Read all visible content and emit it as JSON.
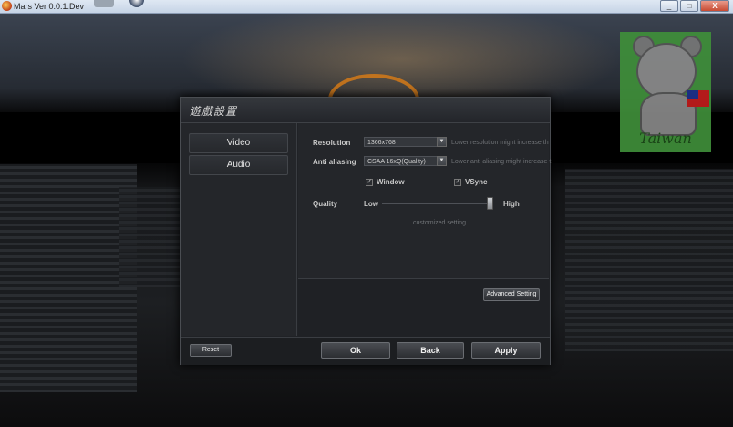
{
  "window": {
    "title": "Mars Ver 0.0.1.Dev",
    "controls": {
      "minimize": "_",
      "maximize": "□",
      "close": "X"
    }
  },
  "background": {
    "watermark_text": "Taiwan",
    "accent_orange": "#d47a18"
  },
  "dialog": {
    "title": "遊戲設置",
    "tabs": [
      {
        "label": "Video",
        "selected": true
      },
      {
        "label": "Audio",
        "selected": false
      }
    ],
    "video": {
      "resolution": {
        "label": "Resolution",
        "value": "1366x768",
        "hint": "Lower resolution might increase th"
      },
      "anti_aliasing": {
        "label": "Anti aliasing",
        "value": "CSAA 16xQ(Quality)",
        "hint": "Lower anti aliasing might increase t"
      },
      "window": {
        "label": "Window",
        "checked": true,
        "mark": "✓"
      },
      "vsync": {
        "label": "VSync",
        "checked": true,
        "mark": "✓"
      },
      "quality": {
        "label": "Quality",
        "low": "Low",
        "high": "High",
        "level": 1.0,
        "note": "customized setting"
      },
      "advanced_button": "Advanced Setting"
    },
    "footer": {
      "reset": "Reset",
      "ok": "Ok",
      "back": "Back",
      "apply": "Apply"
    }
  }
}
